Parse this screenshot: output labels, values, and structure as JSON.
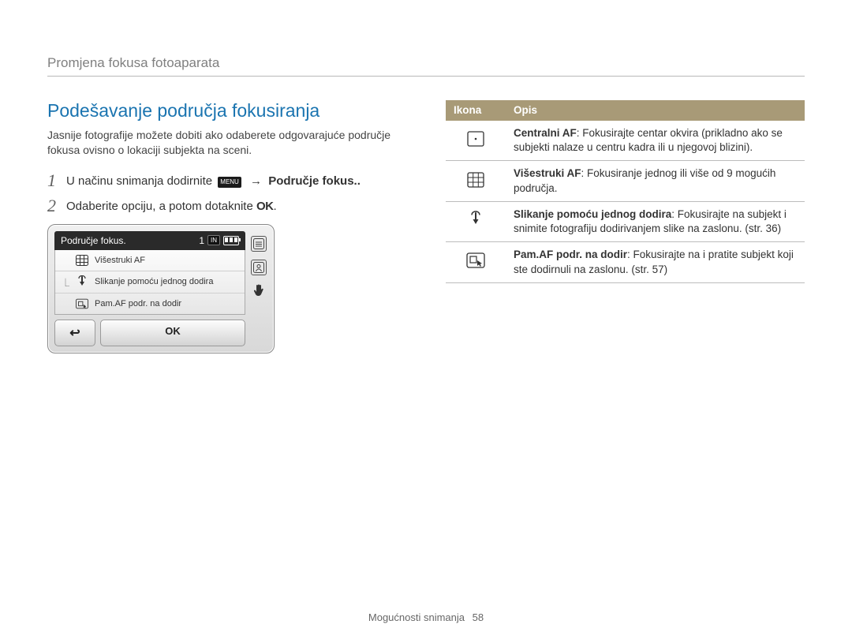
{
  "breadcrumb": "Promjena fokusa fotoaparata",
  "section_title": "Podešavanje područja fokusiranja",
  "intro": "Jasnije fotografije možete dobiti ako odaberete odgovarajuće područje fokusa ovisno o lokaciji subjekta na sceni.",
  "steps": {
    "s1_num": "1",
    "s1_pre": "U načinu snimanja dodirnite",
    "s1_menu": "MENU",
    "s1_arrow": "→",
    "s1_post": "Područje fokus..",
    "s2_num": "2",
    "s2_text": "Odaberite opciju, a potom dotaknite",
    "s2_ok": "OK"
  },
  "cam": {
    "title": "Područje fokus.",
    "count": "1",
    "in_label": "IN",
    "items": [
      {
        "icon": "multi",
        "label": "Višestruki AF"
      },
      {
        "icon": "touch",
        "label": "Slikanje pomoću jednog dodira"
      },
      {
        "icon": "smart",
        "label": "Pam.AF podr. na dodir"
      }
    ],
    "back": "↩",
    "ok": "OK"
  },
  "table": {
    "header_icon": "Ikona",
    "header_desc": "Opis",
    "rows": [
      {
        "icon": "center",
        "term": "Centralni AF",
        "text": ": Fokusirajte centar okvira (prikladno ako se subjekti nalaze u centru kadra ili u njegovoj blizini)."
      },
      {
        "icon": "multi",
        "term": "Višestruki AF",
        "text": ": Fokusiranje jednog ili više od 9 mogućih područja."
      },
      {
        "icon": "touch",
        "term": "Slikanje pomoću jednog dodira",
        "text": ": Fokusirajte na subjekt i snimite fotografiju dodirivanjem slike na zaslonu. (str. 36)"
      },
      {
        "icon": "smart",
        "term": "Pam.AF podr. na dodir",
        "text": ": Fokusirajte na i pratite subjekt koji ste dodirnuli na zaslonu. (str. 57)"
      }
    ]
  },
  "footer": {
    "label": "Mogućnosti snimanja",
    "page": "58"
  }
}
